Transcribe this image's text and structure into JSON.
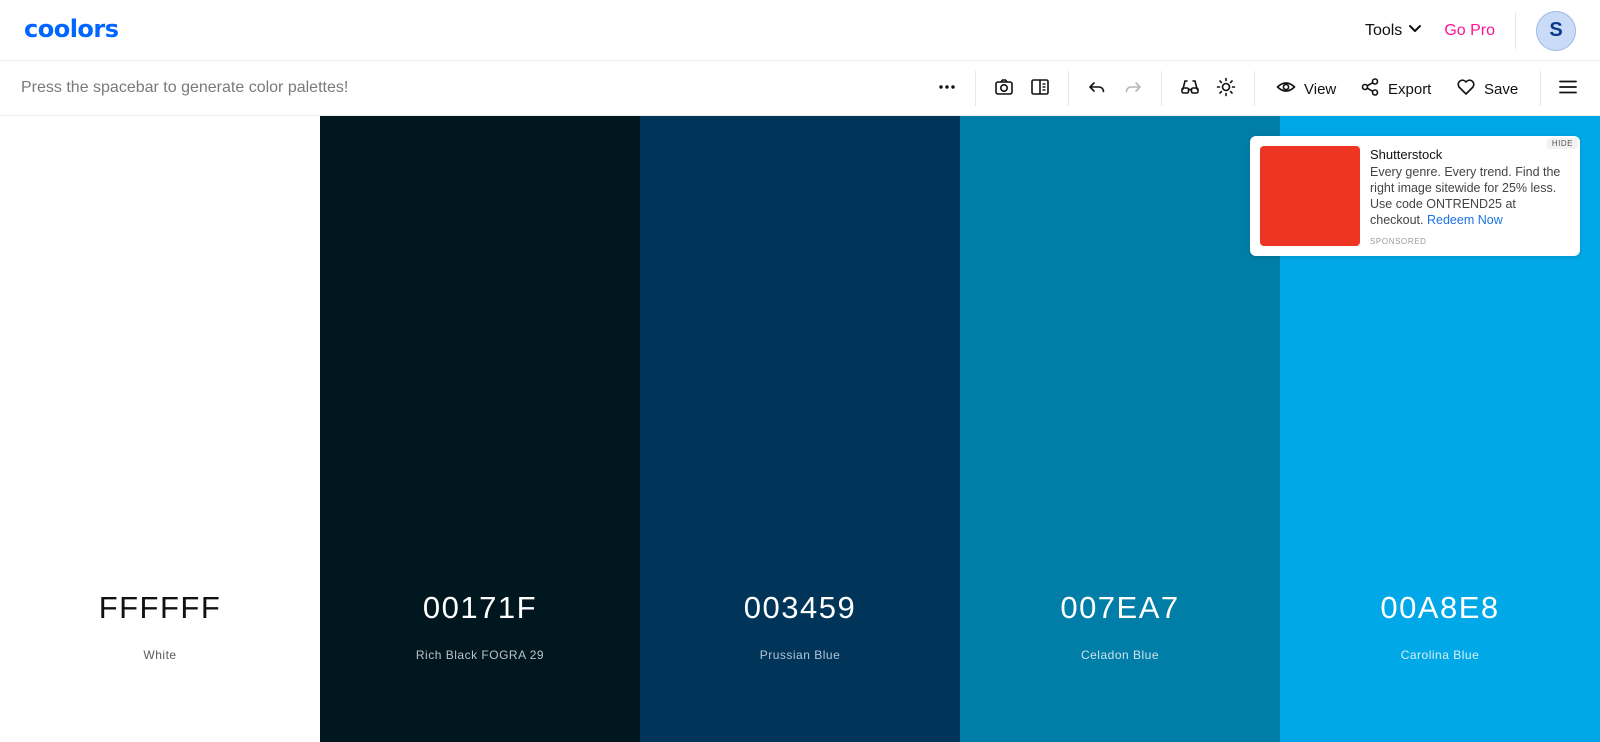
{
  "header": {
    "logo": "coolors",
    "tools_label": "Tools",
    "gopro_label": "Go Pro",
    "avatar_initial": "S",
    "brand_color": "#0066ff",
    "gopro_color": "#ff1493"
  },
  "toolbar": {
    "hint": "Press the spacebar to generate color palettes!",
    "icons": [
      "more-icon",
      "camera-icon",
      "side-panel-icon",
      "undo-icon",
      "redo-icon",
      "glasses-icon",
      "sun-icon"
    ],
    "view_label": "View",
    "export_label": "Export",
    "save_label": "Save"
  },
  "palette": {
    "colors": [
      {
        "hex": "FFFFFF",
        "name": "White",
        "bg": "#FFFFFF",
        "text": "#111111",
        "sub": "#5a5a5a"
      },
      {
        "hex": "00171F",
        "name": "Rich Black FOGRA 29",
        "bg": "#00171F",
        "text": "#ffffff",
        "sub": "#b9c2c6"
      },
      {
        "hex": "003459",
        "name": "Prussian Blue",
        "bg": "#003459",
        "text": "#ffffff",
        "sub": "#b3c5d6"
      },
      {
        "hex": "007EA7",
        "name": "Celadon Blue",
        "bg": "#007EA7",
        "text": "#ffffff",
        "sub": "#cde3ec"
      },
      {
        "hex": "00A8E8",
        "name": "Carolina Blue",
        "bg": "#00A8E8",
        "text": "#ffffff",
        "sub": "#d6f0fb"
      }
    ]
  },
  "ad": {
    "hide_label": "HIDE",
    "title": "Shutterstock",
    "body": "Every genre. Every trend. Find the right image sitewide for 25% less. Use code ONTREND25 at checkout.",
    "link": "Redeem Now",
    "sponsored": "SPONSORED",
    "image_color": "#ee3524"
  }
}
